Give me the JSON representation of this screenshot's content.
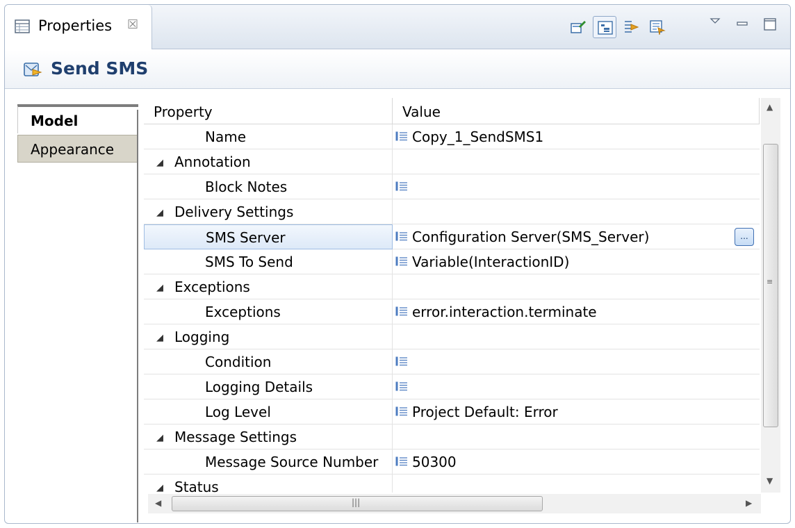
{
  "view_tab": {
    "title": "Properties",
    "close_glyph": "☒",
    "icon": "properties-table-icon"
  },
  "toolbar": {
    "buttons": [
      {
        "icon": "pin-edit-icon"
      },
      {
        "icon": "show-categories-icon",
        "pressed": true
      },
      {
        "icon": "show-advanced-icon"
      },
      {
        "icon": "restore-defaults-icon"
      }
    ],
    "view_menu_icon": "view-menu-triangle-icon",
    "minimize_icon": "minimize-icon",
    "maximize_icon": "maximize-icon"
  },
  "header": {
    "title": "Send SMS",
    "icon": "send-sms-block-icon"
  },
  "side_tabs": [
    {
      "label": "Model",
      "active": true
    },
    {
      "label": "Appearance",
      "active": false
    }
  ],
  "table": {
    "columns": [
      "Property",
      "Value"
    ],
    "rows": [
      {
        "type": "child",
        "label": "Name",
        "value": "Copy_1_SendSMS1"
      },
      {
        "type": "group",
        "label": "Annotation",
        "value": ""
      },
      {
        "type": "child",
        "label": "Block Notes",
        "value": ""
      },
      {
        "type": "group",
        "label": "Delivery Settings",
        "value": ""
      },
      {
        "type": "child",
        "label": "SMS Server",
        "value": "Configuration Server(SMS_Server)",
        "selected": true,
        "button": "..."
      },
      {
        "type": "child",
        "label": "SMS To Send",
        "value": "Variable(InteractionID)"
      },
      {
        "type": "group",
        "label": "Exceptions",
        "value": ""
      },
      {
        "type": "child",
        "label": "Exceptions",
        "value": "error.interaction.terminate"
      },
      {
        "type": "group",
        "label": "Logging",
        "value": ""
      },
      {
        "type": "child",
        "label": "Condition",
        "value": ""
      },
      {
        "type": "child",
        "label": "Logging Details",
        "value": ""
      },
      {
        "type": "child",
        "label": "Log Level",
        "value": "Project Default: Error"
      },
      {
        "type": "group",
        "label": "Message Settings",
        "value": ""
      },
      {
        "type": "child",
        "label": "Message Source Number",
        "value": "50300"
      },
      {
        "type": "group",
        "label": "Status",
        "value": ""
      }
    ],
    "expand_glyph": "◢"
  },
  "scrollbars": {
    "up": "▲",
    "down": "▼",
    "left": "◀",
    "right": "▶",
    "hgrip": "|||",
    "vgrip": "≡"
  }
}
